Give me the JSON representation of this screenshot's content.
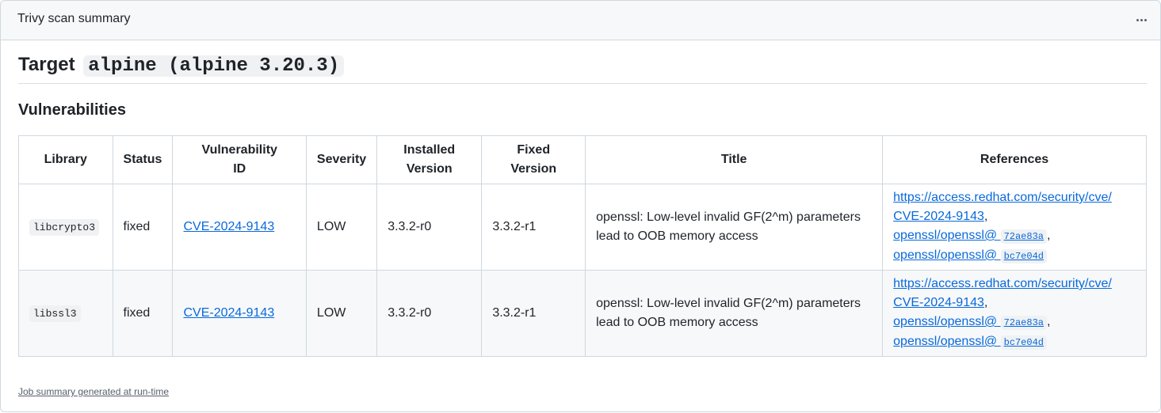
{
  "header": {
    "title": "Trivy scan summary"
  },
  "target": {
    "prefix": "Target",
    "name": "alpine (alpine 3.20.3)"
  },
  "section": {
    "heading": "Vulnerabilities"
  },
  "table": {
    "columns": [
      "Library",
      "Status",
      "Vulnerability ID",
      "Severity",
      "Installed Version",
      "Fixed Version",
      "Title",
      "References"
    ],
    "rows": [
      {
        "library": "libcrypto3",
        "status": "fixed",
        "vuln_id": "CVE-2024-9143",
        "severity": "LOW",
        "installed": "3.3.2-r0",
        "fixed": "3.3.2-r1",
        "title": "openssl: Low-level invalid GF(2^m) parameters lead to OOB memory access",
        "refs": {
          "ref1_a": "https://access.redhat.com/security/cve/",
          "ref1_b": "CVE-2024-9143",
          "ref2": "openssl/openssl@",
          "ref2_hash": "72ae83a",
          "ref3": "openssl/openssl@",
          "ref3_hash": "bc7e04d"
        }
      },
      {
        "library": "libssl3",
        "status": "fixed",
        "vuln_id": "CVE-2024-9143",
        "severity": "LOW",
        "installed": "3.3.2-r0",
        "fixed": "3.3.2-r1",
        "title": "openssl: Low-level invalid GF(2^m) parameters lead to OOB memory access",
        "refs": {
          "ref1_a": "https://access.redhat.com/security/cve/",
          "ref1_b": "CVE-2024-9143",
          "ref2": "openssl/openssl@",
          "ref2_hash": "72ae83a",
          "ref3": "openssl/openssl@",
          "ref3_hash": "bc7e04d"
        }
      }
    ]
  },
  "footer": {
    "note": "Job summary generated at run-time"
  },
  "icons": {
    "menu": "kebab-menu-icon"
  }
}
